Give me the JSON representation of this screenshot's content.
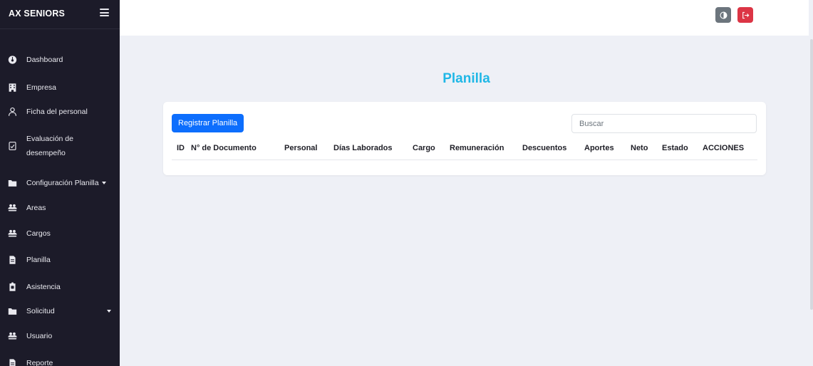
{
  "brand": {
    "title": "AX SENIORS"
  },
  "sidebar": {
    "items": [
      {
        "label": "Dashboard",
        "icon": "dashboard-icon"
      },
      {
        "label": "Empresa",
        "icon": "building-icon"
      },
      {
        "label": "Ficha del personal",
        "icon": "user-icon"
      },
      {
        "label_line1": "Evaluación de",
        "label_line2": "desempeño",
        "icon": "evaluation-icon"
      },
      {
        "label": "Configuración Planilla",
        "icon": "folder-icon",
        "has_submenu": true
      },
      {
        "label": "Areas",
        "icon": "users-icon"
      },
      {
        "label": "Cargos",
        "icon": "users-icon"
      },
      {
        "label": "Planilla",
        "icon": "file-icon"
      },
      {
        "label": "Asistencia",
        "icon": "clipboard-icon"
      },
      {
        "label": "Solicitud",
        "icon": "folder-icon",
        "has_submenu": true
      },
      {
        "label": "Usuario",
        "icon": "users-icon"
      },
      {
        "label": "Reporte",
        "icon": "file-icon"
      }
    ]
  },
  "topbar": {
    "theme_toggle_icon": "contrast-icon",
    "logout_icon": "logout-icon"
  },
  "main": {
    "title": "Planilla",
    "register_button": "Registrar Planilla",
    "search_placeholder": "Buscar",
    "columns": [
      "ID",
      "N° de Documento",
      "Personal",
      "Días Laborados",
      "Cargo",
      "Remuneración",
      "Descuentos",
      "Aportes",
      "Neto",
      "Estado",
      "ACCIONES"
    ]
  },
  "colors": {
    "sidebar_bg": "#1c1b29",
    "title": "#1fb7e6",
    "primary": "#0d6efd",
    "danger": "#dc3545",
    "secondary": "#6c757d",
    "content_bg": "#eef0f6"
  }
}
